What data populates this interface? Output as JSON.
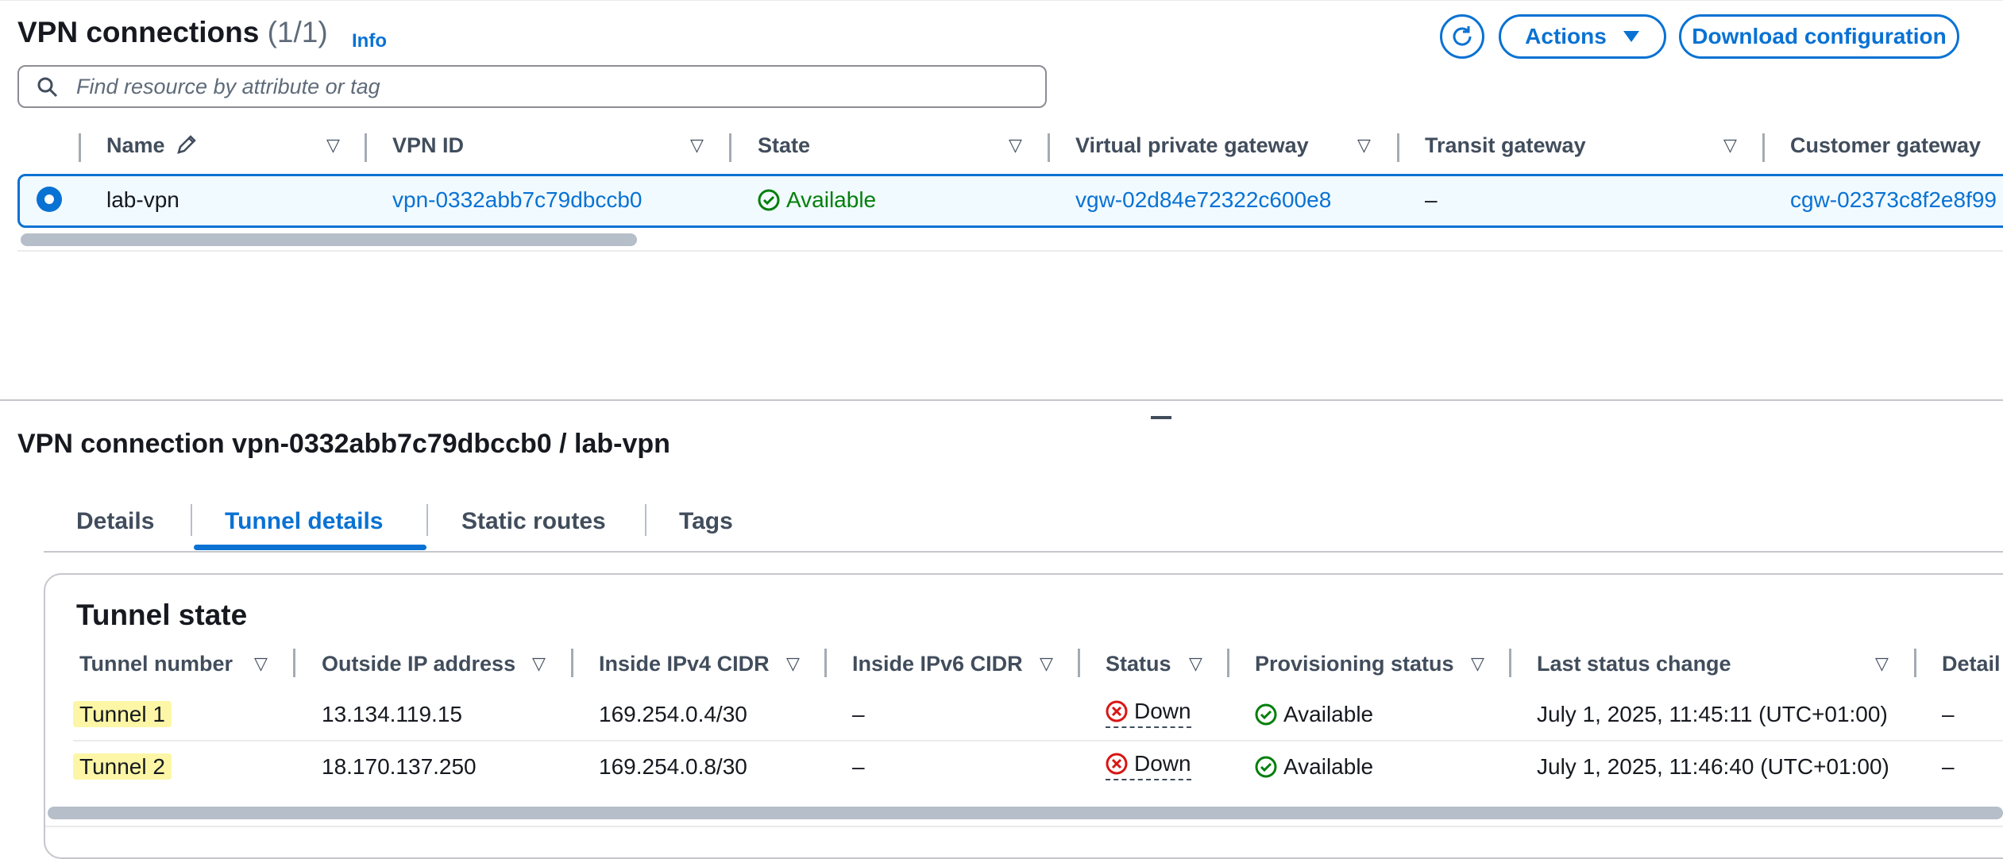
{
  "list": {
    "title": "VPN connections",
    "count": "(1/1)",
    "info": "Info",
    "actions_label": "Actions",
    "download_label": "Download configuration",
    "search_placeholder": "Find resource by attribute or tag",
    "columns": [
      "Name",
      "VPN ID",
      "State",
      "Virtual private gateway",
      "Transit gateway",
      "Customer gateway"
    ],
    "row": {
      "name": "lab-vpn",
      "vpn_id": "vpn-0332abb7c79dbccb0",
      "state": "Available",
      "vgw": "vgw-02d84e72322c600e8",
      "tgw": "–",
      "cgw": "cgw-02373c8f2e8f99"
    }
  },
  "detail": {
    "title": "VPN connection vpn-0332abb7c79dbccb0 / lab-vpn",
    "tabs": [
      "Details",
      "Tunnel details",
      "Static routes",
      "Tags"
    ],
    "active_tab": "Tunnel details"
  },
  "tunnel_state": {
    "title": "Tunnel state",
    "columns": [
      "Tunnel number",
      "Outside IP address",
      "Inside IPv4 CIDR",
      "Inside IPv6 CIDR",
      "Status",
      "Provisioning status",
      "Last status change",
      "Detail"
    ],
    "rows": [
      {
        "tunnel": "Tunnel 1",
        "outside_ip": "13.134.119.15",
        "inside_ipv4": "169.254.0.4/30",
        "inside_ipv6": "–",
        "status": "Down",
        "provisioning": "Available",
        "last_change": "July 1, 2025, 11:45:11 (UTC+01:00)",
        "detail": "–"
      },
      {
        "tunnel": "Tunnel 2",
        "outside_ip": "18.170.137.250",
        "inside_ipv4": "169.254.0.8/30",
        "inside_ipv6": "–",
        "status": "Down",
        "provisioning": "Available",
        "last_change": "July 1, 2025, 11:46:40 (UTC+01:00)",
        "detail": "–"
      }
    ]
  },
  "colors": {
    "accent": "#0972d3",
    "success": "#037f0c",
    "error": "#d91515",
    "highlight": "#fcf6a6"
  },
  "icons": [
    "refresh-icon",
    "caret-down-icon",
    "search-icon",
    "pencil-icon",
    "sort-icon",
    "check-circle-icon",
    "error-circle-icon"
  ]
}
